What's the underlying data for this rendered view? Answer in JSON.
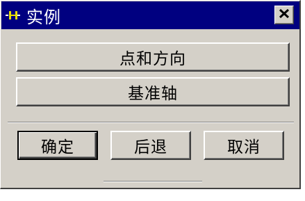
{
  "window": {
    "title": "实例"
  },
  "actions": {
    "point_and_direction": "点和方向",
    "datum_axis": "基准轴"
  },
  "footer": {
    "ok_label": "确定",
    "back_label": "后退",
    "cancel_label": "取消"
  },
  "icons": {
    "title": "ug-app-icon",
    "close": "close-x-icon"
  },
  "colors": {
    "titlebar": "#000080",
    "face": "#d4d0c8"
  }
}
